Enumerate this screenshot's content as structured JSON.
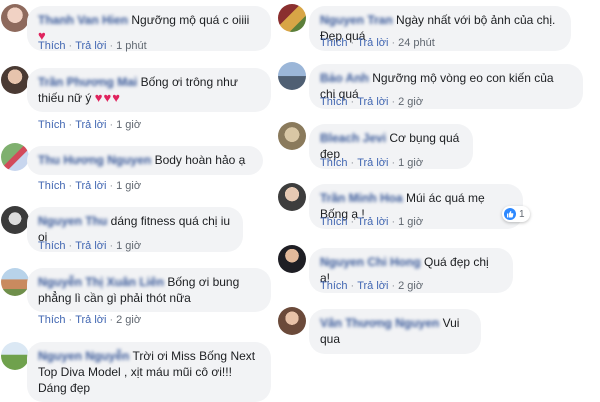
{
  "ui": {
    "like_label": "Thích",
    "reply_label": "Trả lời",
    "sep": "·"
  },
  "left": [
    {
      "author": "Thanh Van Hien",
      "text": "Ngưỡng mộ quá c oiiii",
      "emoji": "♥",
      "time": "1 phút"
    },
    {
      "author": "Trần Phương Mai",
      "text": "Bống ơi trông như thiếu nữ ý",
      "emoji": "♥♥♥",
      "time": "1 giờ"
    },
    {
      "author": "Thu Hương Nguyen",
      "text": "Body hoàn hảo ạ",
      "time": "1 giờ"
    },
    {
      "author": "Nguyen Thu",
      "text": "dáng fitness quá chị iu oi",
      "time": "1 giờ"
    },
    {
      "author": "Nguyễn Thị Xuân Liên",
      "text": "Bống ơi bung phẳng lì cần gì phải thót nữa",
      "time": "2 giờ"
    },
    {
      "author": "Nguyen Nguyễn",
      "text": "Trời ơi Miss Bống Next Top Diva Model , xịt máu mũi cô ơi!!! Dáng đẹp"
    }
  ],
  "right": [
    {
      "author": "Nguyen Tran",
      "text": "Ngày nhất với bộ ảnh của chị. Đẹp quá",
      "time": "24 phút"
    },
    {
      "author": "Bảo Anh",
      "text": "Ngưỡng mộ vòng eo con kiến của chị quá",
      "time": "2 giờ"
    },
    {
      "author": "Bleach Jevi",
      "text": "Cơ bụng quá đẹp",
      "time": "1 giờ"
    },
    {
      "author": "Trần Minh Hoa",
      "text": "Múi ác quá mẹ Bống ạ !",
      "time": "1 giờ",
      "reaction_count": "1"
    },
    {
      "author": "Nguyen Chi Hong",
      "text": "Quá đẹp chị ạ!",
      "time": "2 giờ"
    },
    {
      "author": "Vân Thương Nguyen",
      "text": "Vui qua"
    }
  ],
  "colors": {
    "link": "#4267b2",
    "author": "#385898",
    "bubble": "#f2f3f5",
    "heart": "#e0245e",
    "like": "#2d88ff"
  }
}
